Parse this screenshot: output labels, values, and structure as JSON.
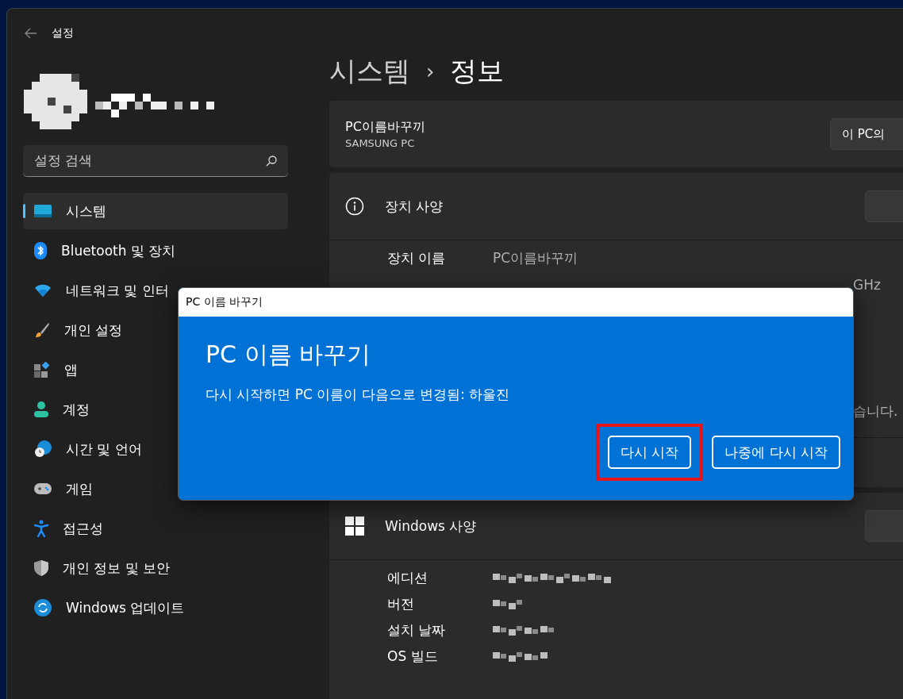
{
  "window": {
    "title": "설정"
  },
  "search": {
    "placeholder": "설정 검색"
  },
  "sidebar": {
    "items": [
      {
        "label": "시스템",
        "selected": true
      },
      {
        "label": "Bluetooth 및 장치",
        "selected": false
      },
      {
        "label": "네트워크 및 인터",
        "selected": false
      },
      {
        "label": "개인 설정",
        "selected": false
      },
      {
        "label": "앱",
        "selected": false
      },
      {
        "label": "계정",
        "selected": false
      },
      {
        "label": "시간 및 언어",
        "selected": false
      },
      {
        "label": "게임",
        "selected": false
      },
      {
        "label": "접근성",
        "selected": false
      },
      {
        "label": "개인 정보 및 보안",
        "selected": false
      },
      {
        "label": "Windows 업데이트",
        "selected": false
      }
    ]
  },
  "breadcrumb": {
    "parent": "시스템",
    "separator": "›",
    "current": "정보"
  },
  "pc_card": {
    "name": "PC이름바꾸끼",
    "model": "SAMSUNG PC",
    "button": "이 PC의"
  },
  "device_specs": {
    "title": "장치 사양",
    "rows": [
      {
        "kind": "row",
        "label": "장치 이름",
        "value": "PC이름바꾸끼"
      },
      {
        "kind": "fragment",
        "text": "GHz"
      },
      {
        "kind": "fragment",
        "text": "습니다."
      }
    ]
  },
  "windows_specs": {
    "title": "Windows 사양",
    "rows": [
      {
        "label": "에디션"
      },
      {
        "label": "버전"
      },
      {
        "label": "설치 날짜"
      },
      {
        "label": "OS 빌드"
      }
    ]
  },
  "dialog": {
    "title": "PC 이름 바꾸기",
    "heading": "PC 이름 바꾸기",
    "message": "다시 시작하면 PC 이름이 다음으로 변경됨: 하울진",
    "buttons": [
      {
        "label": "다시 시작",
        "highlighted": true
      },
      {
        "label": "나중에 다시 시작",
        "highlighted": false
      }
    ]
  }
}
